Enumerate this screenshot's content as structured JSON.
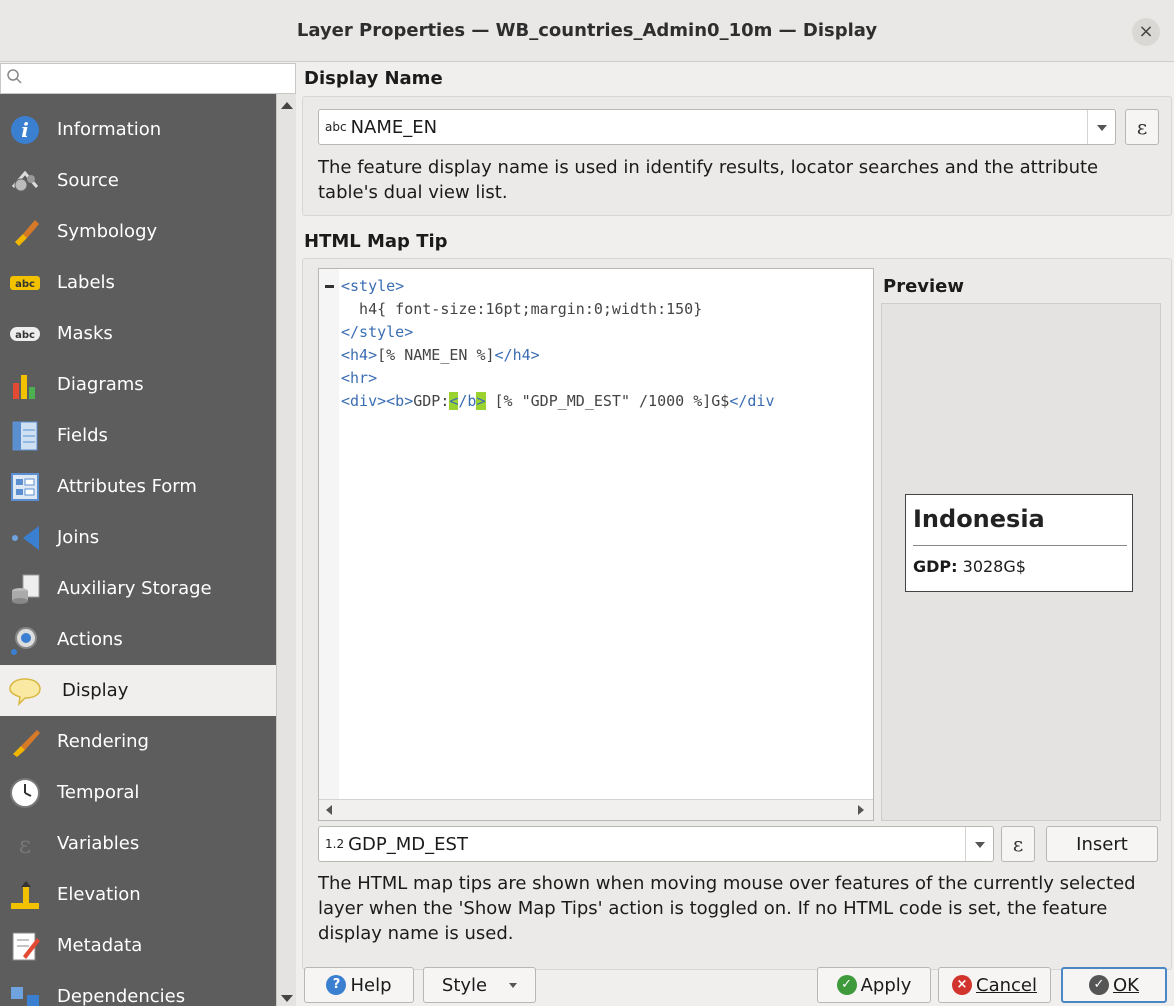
{
  "window": {
    "title": "Layer Properties — WB_countries_Admin0_10m — Display",
    "close_glyph": "×"
  },
  "sidebar": {
    "search_icon": "search-icon",
    "items": [
      {
        "label": "Information",
        "icon": "information-icon"
      },
      {
        "label": "Source",
        "icon": "source-icon"
      },
      {
        "label": "Symbology",
        "icon": "symbology-icon"
      },
      {
        "label": "Labels",
        "icon": "labels-icon"
      },
      {
        "label": "Masks",
        "icon": "masks-icon"
      },
      {
        "label": "Diagrams",
        "icon": "diagrams-icon"
      },
      {
        "label": "Fields",
        "icon": "fields-icon"
      },
      {
        "label": "Attributes Form",
        "icon": "attributes-form-icon"
      },
      {
        "label": "Joins",
        "icon": "joins-icon"
      },
      {
        "label": "Auxiliary Storage",
        "icon": "auxiliary-storage-icon"
      },
      {
        "label": "Actions",
        "icon": "actions-icon"
      },
      {
        "label": "Display",
        "icon": "display-icon",
        "active": true
      },
      {
        "label": "Rendering",
        "icon": "rendering-icon"
      },
      {
        "label": "Temporal",
        "icon": "temporal-icon"
      },
      {
        "label": "Variables",
        "icon": "variables-icon"
      },
      {
        "label": "Elevation",
        "icon": "elevation-icon"
      },
      {
        "label": "Metadata",
        "icon": "metadata-icon"
      },
      {
        "label": "Dependencies",
        "icon": "dependencies-icon"
      }
    ]
  },
  "display_name": {
    "heading": "Display Name",
    "field_prefix": "abc",
    "field_value": "NAME_EN",
    "expression_glyph": "ε",
    "hint": "The feature display name is used in identify results, locator searches and the attribute table's dual view list."
  },
  "map_tip": {
    "heading": "HTML Map Tip",
    "code_lines": {
      "l1": "<style>",
      "l2": "  h4{ font-size:16pt;margin:0;width:150}",
      "l3": "</style>",
      "l4": "<h4>",
      "l4b": "[% NAME_EN %]",
      "l4c": "</h4>",
      "l5": "<hr>",
      "l6a": "<div><b>",
      "l6b": "GDP:",
      "l6c": "<",
      "l6d": "/b",
      "l6e": ">",
      "l6f": " [% \"GDP_MD_EST\" /1000 %]G$",
      "l6g": "</div"
    },
    "preview_heading": "Preview",
    "preview": {
      "title": "Indonesia",
      "gdp_label": "GDP:",
      "gdp_value": " 3028G$"
    },
    "field_prefix": "1.2",
    "field_value": "GDP_MD_EST",
    "expression_glyph": "ε",
    "insert_label": "Insert",
    "hint": "The HTML map tips are shown when moving mouse over features of the currently selected layer when the 'Show Map Tips' action is toggled on. If no HTML code is set, the feature display name is used."
  },
  "buttons": {
    "help": "Help",
    "style": "Style",
    "apply": "Apply",
    "cancel": "Cancel",
    "ok": "OK"
  },
  "colors": {
    "sidebar_bg": "#5d5d5d",
    "code_tag": "#3b6db3",
    "match_highlight": "#9ad22f",
    "ok_border": "#4a87c7"
  }
}
